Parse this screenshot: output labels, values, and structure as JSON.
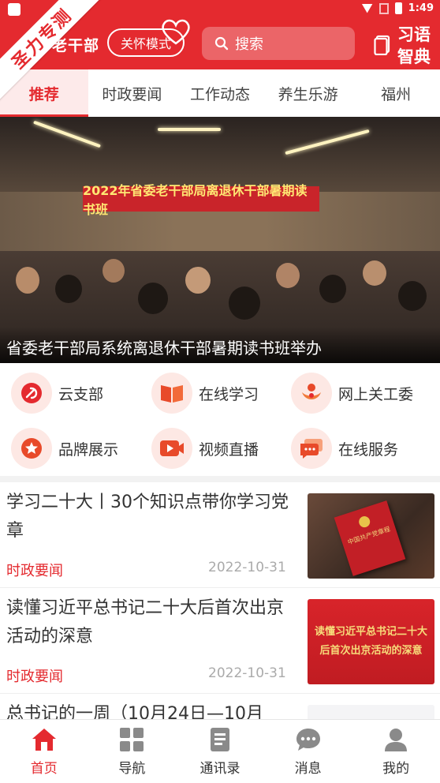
{
  "status_bar": {
    "time": "1:49"
  },
  "header": {
    "logo_text": "老干部",
    "care_mode_label": "关怀模式",
    "search_placeholder": "搜索",
    "dict_line1": "习语",
    "dict_line2": "智典",
    "ribbon_text": "圣力专测"
  },
  "tabs": [
    {
      "label": "推荐",
      "active": true
    },
    {
      "label": "时政要闻"
    },
    {
      "label": "工作动态"
    },
    {
      "label": "养生乐游"
    },
    {
      "label": "福州"
    }
  ],
  "banner": {
    "sign_text": "2022年省委老干部局离退休干部暑期读书班",
    "caption": "省委老干部局系统离退休干部暑期读书班举办"
  },
  "services": [
    {
      "label": "云支部",
      "icon": "party-emblem-icon"
    },
    {
      "label": "在线学习",
      "icon": "open-book-icon"
    },
    {
      "label": "网上关工委",
      "icon": "care-people-icon"
    },
    {
      "label": "品牌展示",
      "icon": "star-badge-icon"
    },
    {
      "label": "视频直播",
      "icon": "video-play-icon"
    },
    {
      "label": "在线服务",
      "icon": "chat-bubbles-icon"
    }
  ],
  "news": [
    {
      "title": "学习二十大丨30个知识点带你学习党章",
      "category": "时政要闻",
      "date": "2022-10-31",
      "thumb_text": "中国共产党章程"
    },
    {
      "title": "读懂习近平总书记二十大后首次出京活动的深意",
      "category": "时政要闻",
      "date": "2022-10-31",
      "thumb_text": "读懂习近平总书记二十大后首次出京活动的深意"
    },
    {
      "title": "总书记的一周（10月24日—10月",
      "category": "",
      "date": ""
    }
  ],
  "bottom_nav": [
    {
      "label": "首页",
      "icon": "home-icon",
      "active": true
    },
    {
      "label": "导航",
      "icon": "grid-icon"
    },
    {
      "label": "通讯录",
      "icon": "contacts-book-icon"
    },
    {
      "label": "消息",
      "icon": "message-icon"
    },
    {
      "label": "我的",
      "icon": "user-icon"
    }
  ],
  "colors": {
    "brand_red": "#e42a2f",
    "tab_active_bg": "#fdeaea"
  }
}
